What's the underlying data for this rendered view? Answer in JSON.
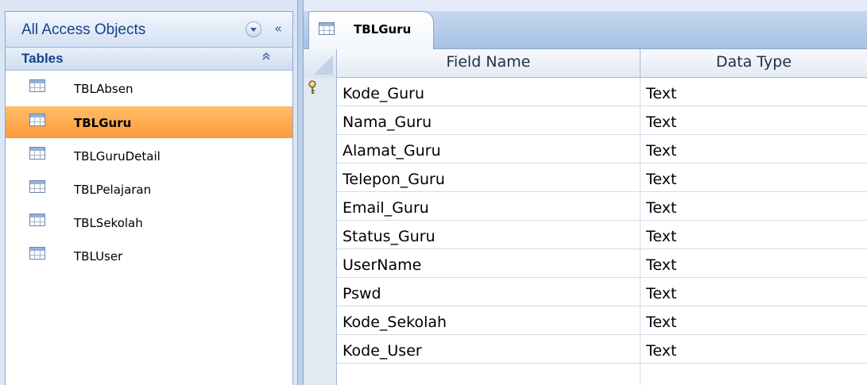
{
  "nav_pane": {
    "title": "All Access Objects",
    "collapse_label": "«",
    "group": {
      "title": "Tables",
      "collapse_label": "⌃"
    },
    "items": [
      {
        "label": "TBLAbsen",
        "icon": "table-icon",
        "selected": false
      },
      {
        "label": "TBLGuru",
        "icon": "table-icon",
        "selected": true
      },
      {
        "label": "TBLGuruDetail",
        "icon": "table-icon",
        "selected": false
      },
      {
        "label": "TBLPelajaran",
        "icon": "table-icon",
        "selected": false
      },
      {
        "label": "TBLSekolah",
        "icon": "table-icon",
        "selected": false
      },
      {
        "label": "TBLUser",
        "icon": "table-icon",
        "selected": false
      }
    ],
    "colors": {
      "selected_bg": "#fe9a3a",
      "title": "#15428b"
    }
  },
  "document": {
    "tab": {
      "label": "TBLGuru",
      "icon": "table-icon"
    },
    "columns": {
      "field_name": "Field Name",
      "data_type": "Data Type"
    },
    "rows": [
      {
        "field": "Kode_Guru",
        "type": "Text",
        "primary_key": true
      },
      {
        "field": "Nama_Guru",
        "type": "Text",
        "primary_key": false
      },
      {
        "field": "Alamat_Guru",
        "type": "Text",
        "primary_key": false
      },
      {
        "field": "Telepon_Guru",
        "type": "Text",
        "primary_key": false
      },
      {
        "field": "Email_Guru",
        "type": "Text",
        "primary_key": false
      },
      {
        "field": "Status_Guru",
        "type": "Text",
        "primary_key": false
      },
      {
        "field": "UserName",
        "type": "Text",
        "primary_key": false
      },
      {
        "field": "Pswd",
        "type": "Text",
        "primary_key": false
      },
      {
        "field": "Kode_Sekolah",
        "type": "Text",
        "primary_key": false
      },
      {
        "field": "Kode_User",
        "type": "Text",
        "primary_key": false
      },
      {
        "field": "",
        "type": "",
        "primary_key": false
      }
    ]
  }
}
